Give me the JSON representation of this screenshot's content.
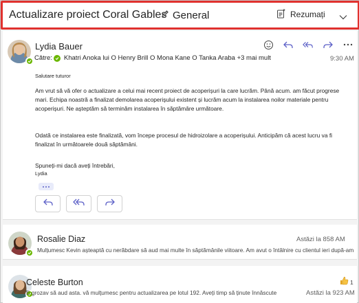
{
  "header": {
    "title": "Actualizare proiect Coral Gables",
    "channel": "General",
    "summarize_label": "Rezumați"
  },
  "main_message": {
    "sender": "Lydia Bauer",
    "to_prefix": "Către:",
    "recipients": "Khatri Anoka lui O Henry Brill O Mona Kane O Tanka Araba +3 mai mult",
    "time": "9:30 AM",
    "greeting": "Salutare tuturor",
    "paragraph1": "Am vrut să vă ofer o actualizare a celui mai recent proiect de acoperișuri la care lucrăm. Până acum. am făcut progrese mari. Echipa noastră a finalizat demolarea acoperișului existent și lucrăm acum la instalarea noilor materiale pentru acoperișuri. Ne așteptăm să terminăm instalarea în săptămâre următoare.",
    "paragraph2": "Odată ce instalarea este finalizată, vom începe procesul de hidroizolare a acoperișului. Anticipăm că acest lucru va fi finalizat în următoarele două săptămâni.",
    "sign_line": "Spuneți-mi dacă aveți întrebări,",
    "sign_name": "Lydia"
  },
  "messages": [
    {
      "sender": "Rosalie Diaz",
      "time": "Astăzi la 858 AM",
      "preview": "Mulțumesc Kevin așteaptă cu nerăbdare să aud mai multe în săptămânile viitoare. Am avut o întâlnire cu clientul ieri după-amiază și"
    },
    {
      "sender": "Celeste Burton",
      "time": "Astăzi la 923 AM",
      "reaction_count": "1",
      "preview": "E grozav să aud asta. vă mulțumesc pentru actualizarea pe lotul 192. Aveți timp să ținute înnăscute"
    }
  ],
  "icons": {
    "channel": "pencil-icon",
    "summarize": "summary-sparkle-icon",
    "emoji": "emoji-icon",
    "reply": "reply-icon",
    "reply_all": "reply-all-icon",
    "forward": "forward-icon",
    "more": "more-icon"
  },
  "colors": {
    "highlight_border": "#e0312e",
    "accent": "#5b5fc7",
    "presence": "#6bb700"
  }
}
